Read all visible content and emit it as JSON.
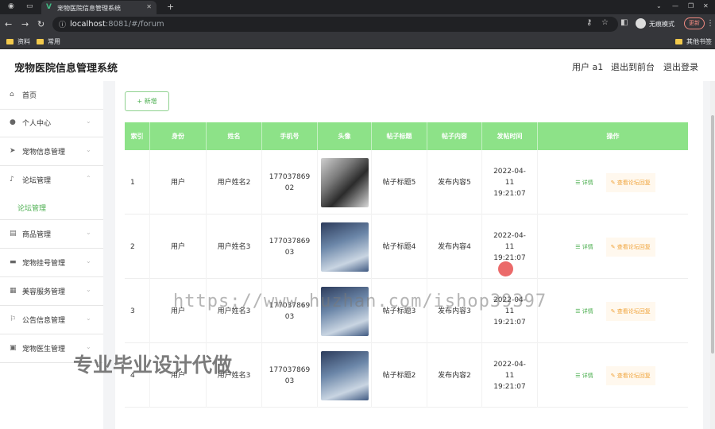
{
  "browser": {
    "tab_title": "宠物医院信息管理系统",
    "url": "localhost",
    "url_rest": ":8081/#/forum",
    "profile_label": "无痕模式",
    "update_label": "更新",
    "bookmarks": [
      "资料",
      "常用"
    ],
    "other_bookmarks": "其他书签"
  },
  "header": {
    "title": "宠物医院信息管理系统",
    "user": "用户 a1",
    "to_front": "退出到前台",
    "logout": "退出登录"
  },
  "sidebar": {
    "items": [
      {
        "label": "首页",
        "icon": "home-icon"
      },
      {
        "label": "个人中心",
        "icon": "user-icon"
      },
      {
        "label": "宠物信息管理",
        "icon": "send-icon"
      },
      {
        "label": "论坛管理",
        "icon": "mic-icon"
      },
      {
        "label": "商品管理",
        "icon": "grid-icon"
      },
      {
        "label": "宠物挂号管理",
        "icon": "chat-icon"
      },
      {
        "label": "美容服务管理",
        "icon": "list-icon"
      },
      {
        "label": "公告信息管理",
        "icon": "notice-icon"
      },
      {
        "label": "宠物医生管理",
        "icon": "board-icon"
      }
    ],
    "active_sub": "论坛管理"
  },
  "toolbar": {
    "add_label": "+ 新增"
  },
  "table": {
    "headers": [
      "索引",
      "身份",
      "姓名",
      "手机号",
      "头像",
      "帖子标题",
      "帖子内容",
      "发帖时间",
      "操作"
    ],
    "detail_label": "详情",
    "reply_label": "查看论坛回复",
    "rows": [
      {
        "index": "1",
        "role": "用户",
        "name": "用户姓名2",
        "phone": "17703786902",
        "avatar": "a",
        "title": "帖子标题5",
        "content": "发布内容5",
        "time": "2022-04-11 19:21:07"
      },
      {
        "index": "2",
        "role": "用户",
        "name": "用户姓名3",
        "phone": "17703786903",
        "avatar": "b",
        "title": "帖子标题4",
        "content": "发布内容4",
        "time": "2022-04-11 19:21:07"
      },
      {
        "index": "3",
        "role": "用户",
        "name": "用户姓名3",
        "phone": "17703786903",
        "avatar": "b",
        "title": "帖子标题3",
        "content": "发布内容3",
        "time": "2022-04-11 19:21:07"
      },
      {
        "index": "4",
        "role": "用户",
        "name": "用户姓名3",
        "phone": "17703786903",
        "avatar": "b",
        "title": "帖子标题2",
        "content": "发布内容2",
        "time": "2022-04-11 19:21:07"
      }
    ]
  },
  "watermarks": {
    "url": "https://www.huzhan.com/ishop39397",
    "cn": "专业毕业设计代做"
  }
}
